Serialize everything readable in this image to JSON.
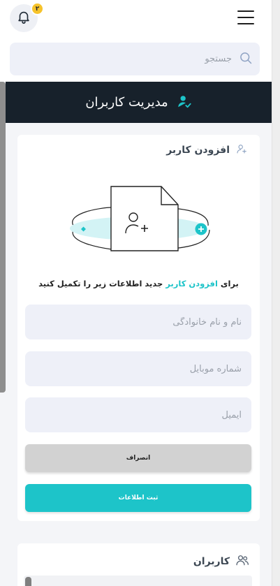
{
  "topbar": {
    "notification_count": "۲",
    "search_placeholder": "جستجو"
  },
  "header": {
    "title": "مدیریت کاربران"
  },
  "add_user_card": {
    "title": "افزودن کاربر",
    "prompt_before": "برای ",
    "prompt_accent": "افزودن کاربر",
    "prompt_after": " جدید اطلاعات زیر را تکمیل کنید",
    "fields": {
      "full_name_placeholder": "نام و نام خانوادگی",
      "mobile_placeholder": "شماره موبایل",
      "email_placeholder": "ایمیل"
    },
    "cancel_label": "انصراف",
    "submit_label": "ثبت اطلاعات"
  },
  "users_card": {
    "title": "کاربران"
  },
  "colors": {
    "accent": "#1dc4c9",
    "header_bg": "#17212b",
    "badge": "#f6c32b"
  },
  "icons": {
    "bell": "bell-icon",
    "menu": "hamburger-menu-icon",
    "search": "search-icon",
    "header": "user-check-icon",
    "add_user": "user-plus-icon",
    "users": "users-icon"
  }
}
